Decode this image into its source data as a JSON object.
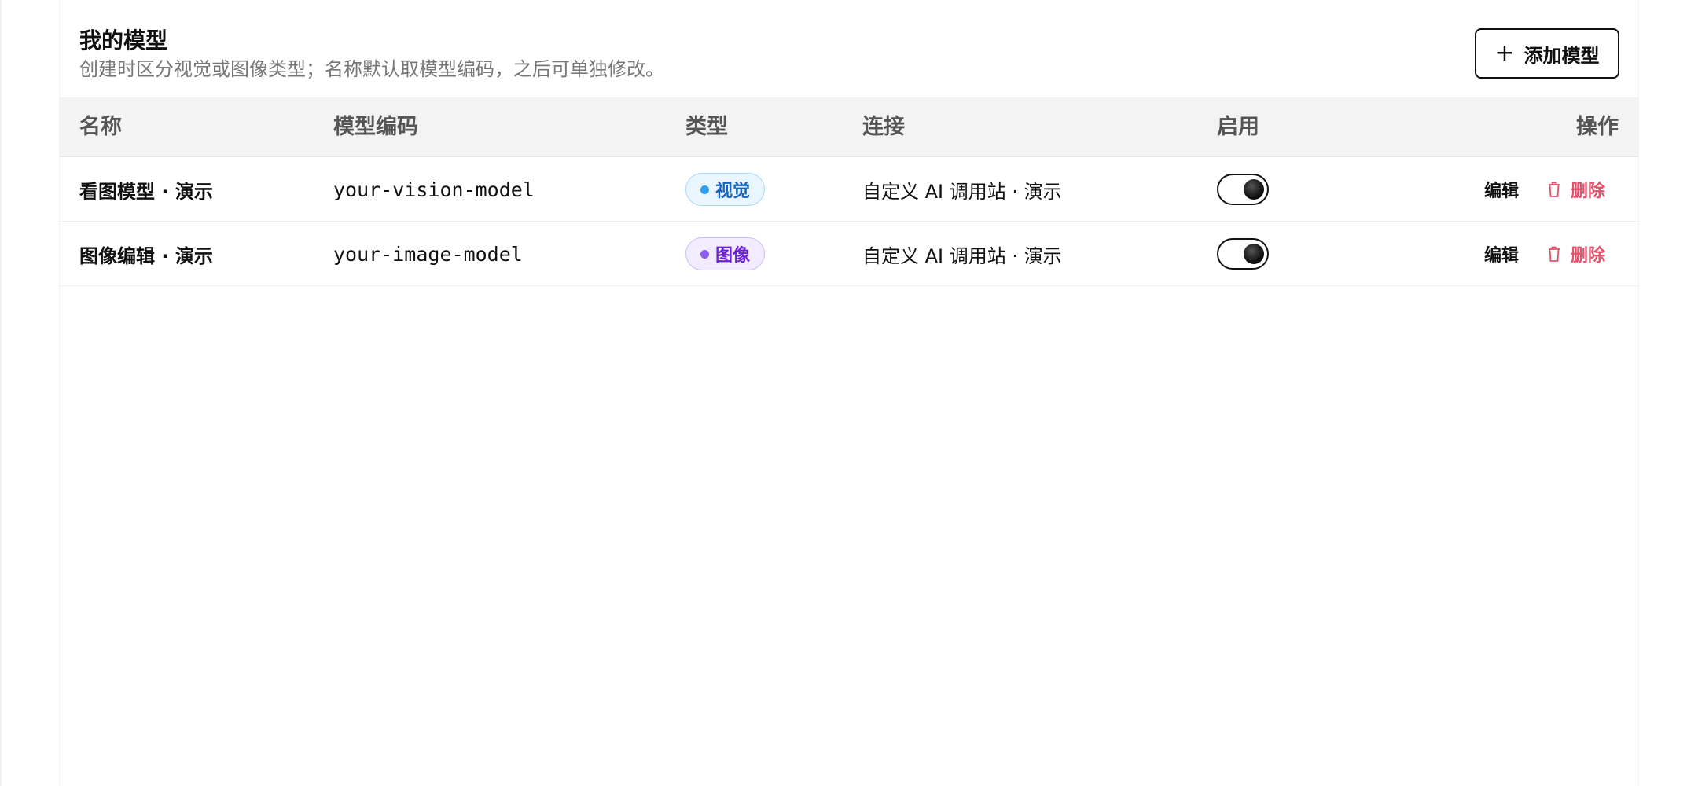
{
  "header": {
    "title": "我的模型",
    "subtitle": "创建时区分视觉或图像类型；名称默认取模型编码，之后可单独修改。",
    "add_button_label": "添加模型"
  },
  "table": {
    "columns": {
      "name": "名称",
      "code": "模型编码",
      "type": "类型",
      "connection": "连接",
      "enabled": "启用",
      "actions": "操作"
    },
    "rows": [
      {
        "name": "看图模型 · 演示",
        "code": "your-vision-model",
        "type": "视觉",
        "connection": "自定义 AI 调用站 · 演示",
        "enabled": true,
        "edit_label": "编辑",
        "delete_label": "删除"
      },
      {
        "name": "图像编辑 · 演示",
        "code": "your-image-model",
        "type": "图像",
        "connection": "自定义 AI 调用站 · 演示",
        "enabled": true,
        "edit_label": "编辑",
        "delete_label": "删除"
      }
    ]
  },
  "colors": {
    "vision_badge": "#2f9ef5",
    "image_badge": "#8b5cf6",
    "delete": "#e5506b"
  }
}
